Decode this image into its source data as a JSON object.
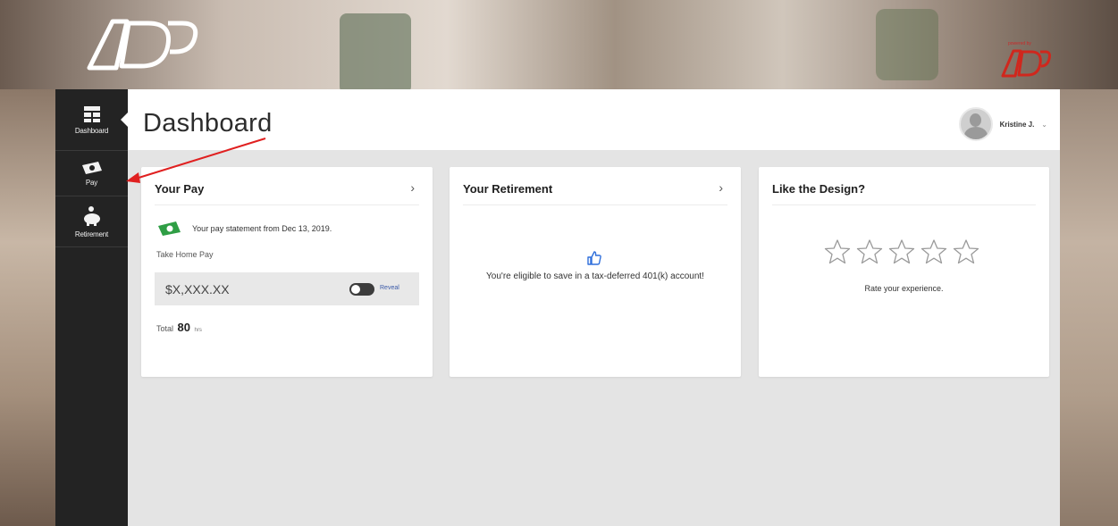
{
  "brand": {
    "logo_text": "ADP",
    "powered_by": "powered by",
    "accent_red": "#d0271d"
  },
  "sidebar": {
    "items": [
      {
        "label": "Dashboard",
        "icon": "dashboard-grid-icon"
      },
      {
        "label": "Pay",
        "icon": "money-icon"
      },
      {
        "label": "Retirement",
        "icon": "piggy-bank-icon"
      }
    ]
  },
  "header": {
    "title": "Dashboard",
    "user_name": "Kristine J.",
    "user_chevron": "⌄"
  },
  "cards": {
    "pay": {
      "title": "Your Pay",
      "chevron": "›",
      "statement_text": "Your pay statement from Dec 13, 2019.",
      "take_home_label": "Take Home Pay",
      "amount": "$X,XXX.XX",
      "reveal_label": "Reveal",
      "total_label": "Total",
      "total_value": "80",
      "total_unit": "hrs"
    },
    "retirement": {
      "title": "Your Retirement",
      "chevron": "›",
      "message": "You're eligible to save in a tax-deferred 401(k) account!"
    },
    "design": {
      "title": "Like the Design?",
      "star_count": 5,
      "rating": 0,
      "rate_label": "Rate your experience."
    }
  },
  "annotation": {
    "arrow_color": "#e02020"
  }
}
